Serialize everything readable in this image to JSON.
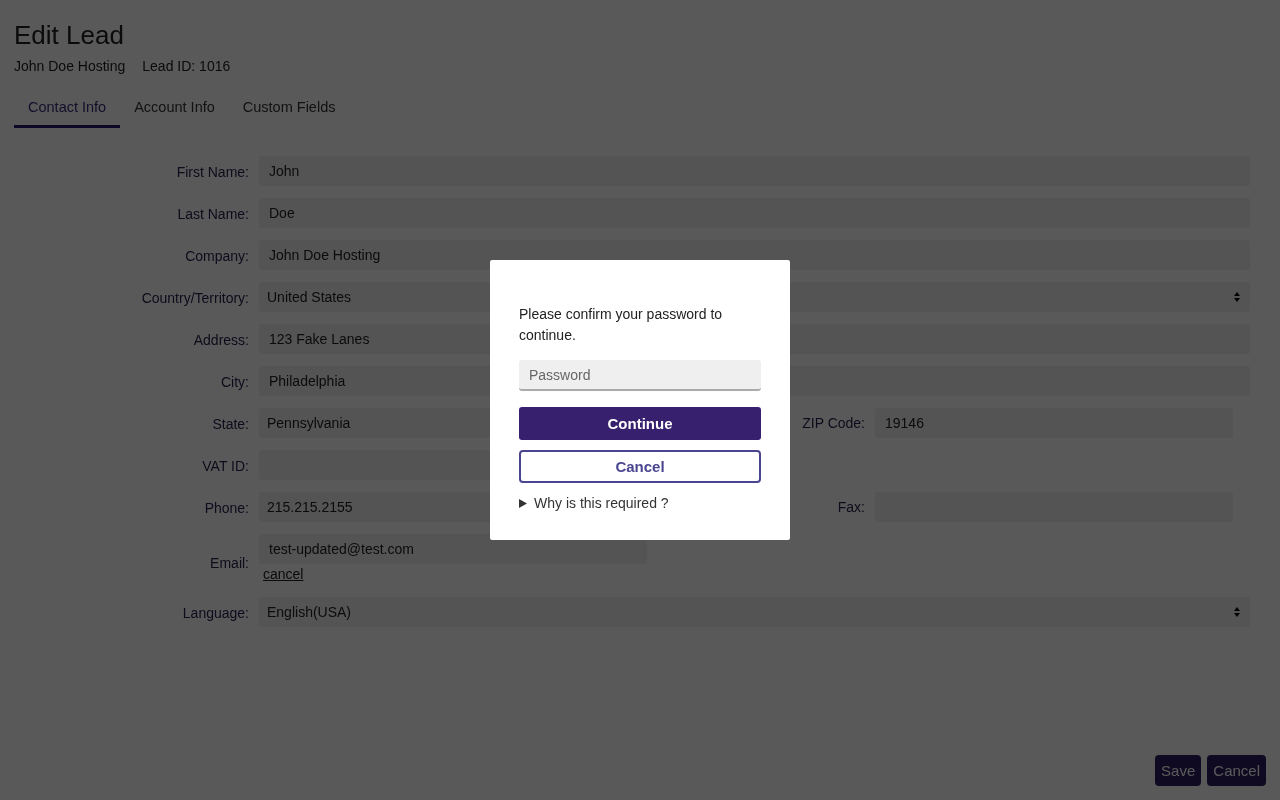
{
  "page": {
    "title": "Edit Lead",
    "company": "John Doe Hosting",
    "lead_id": "Lead ID: 1016"
  },
  "tabs": [
    {
      "label": "Contact Info",
      "selected": true
    },
    {
      "label": "Account Info",
      "selected": false
    },
    {
      "label": "Custom Fields",
      "selected": false
    }
  ],
  "form": [
    {
      "kind": "text",
      "label": "First Name:",
      "value": "John"
    },
    {
      "kind": "text",
      "label": "Last Name:",
      "value": "Doe"
    },
    {
      "kind": "text",
      "label": "Company:",
      "value": "John Doe Hosting"
    },
    {
      "kind": "select",
      "label": "Country/Territory:",
      "value": "United States"
    },
    {
      "kind": "text",
      "label": "Address:",
      "value": "123 Fake Lanes"
    },
    {
      "kind": "text",
      "label": "City:",
      "value": "Philadelphia"
    },
    {
      "kind": "pair",
      "label": "State:",
      "value": "Pennsylvania",
      "label2": "ZIP Code:",
      "value2": "19146"
    },
    {
      "kind": "single",
      "label": "VAT ID:"
    },
    {
      "kind": "pair",
      "label": "Phone:",
      "value": "215.215.2155",
      "label2": "Fax:"
    },
    {
      "kind": "email",
      "label": "Email:",
      "value": "test-updated@test.com",
      "link": "cancel"
    },
    {
      "kind": "select",
      "label": "Language:",
      "value": "English(USA)"
    }
  ],
  "footer_buttons": [
    "Save",
    "Cancel"
  ],
  "dialog": {
    "message": "Please confirm your password to continue.",
    "placeholder": "Password",
    "primary": "Continue",
    "secondary": "Cancel",
    "disclosure": "Why is this required ?",
    "expanded": false
  }
}
